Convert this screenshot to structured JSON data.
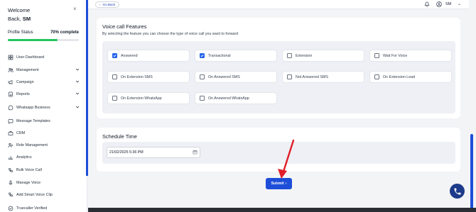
{
  "sidebar": {
    "welcome": "Welcome",
    "user_line_prefix": "Back, ",
    "user_initials": "SM",
    "close_glyph": "×",
    "profile_status_label": "Profile Status",
    "profile_complete_text": "70% complete",
    "profile_progress": 0.7,
    "items": [
      {
        "label": "User Dashboard",
        "icon": "grid-icon",
        "has_chevron": false
      },
      {
        "label": "Management",
        "icon": "users-icon",
        "has_chevron": true
      },
      {
        "label": "Campaign",
        "icon": "megaphone-icon",
        "has_chevron": true
      },
      {
        "label": "Reports",
        "icon": "report-icon",
        "has_chevron": true
      },
      {
        "label": "Whatsapp Business",
        "icon": "whatsapp-icon",
        "has_chevron": true
      },
      {
        "label": "Message Templates",
        "icon": "message-icon",
        "has_chevron": false
      },
      {
        "label": "CRM",
        "icon": "crm-icon",
        "has_chevron": false
      },
      {
        "label": "Role Management",
        "icon": "role-icon",
        "has_chevron": false
      },
      {
        "label": "Analytics",
        "icon": "analytics-icon",
        "has_chevron": false
      },
      {
        "label": "Bulk Voice Call",
        "icon": "bulk-call-icon",
        "has_chevron": false
      },
      {
        "label": "Manage Voice",
        "icon": "mic-icon",
        "has_chevron": false
      },
      {
        "label": "Add Smart Voice Clip",
        "icon": "phone-icon",
        "has_chevron": false
      },
      {
        "label": "Truecaller Verified",
        "icon": "verified-icon",
        "has_chevron": false
      }
    ]
  },
  "topbar": {
    "go_back": "Go Back",
    "user_initials": "SM"
  },
  "voice_call": {
    "title": "Voice call Features",
    "subtitle": "By selecting the feature you can choose the type of voice call you want to forward",
    "features": [
      {
        "label": "Answered",
        "checked": true
      },
      {
        "label": "Transactional",
        "checked": true
      },
      {
        "label": "Extension",
        "checked": false
      },
      {
        "label": "Wait For Voice",
        "checked": false
      },
      {
        "label": "On Extension SMS",
        "checked": false
      },
      {
        "label": "On Answered SMS",
        "checked": false
      },
      {
        "label": "Not Answered SMS",
        "checked": false
      },
      {
        "label": "On Extension Lead",
        "checked": false
      },
      {
        "label": "On Extension WhatsApp",
        "checked": false
      },
      {
        "label": "On Answered WhatsApp",
        "checked": false
      }
    ]
  },
  "schedule": {
    "title": "Schedule Time",
    "value": "21/02/2025 5:36 PM"
  },
  "submit_label": "Submit",
  "colors": {
    "accent": "#1d4ed8",
    "progress": "#22c55e",
    "annotation": "#e11d2a"
  }
}
